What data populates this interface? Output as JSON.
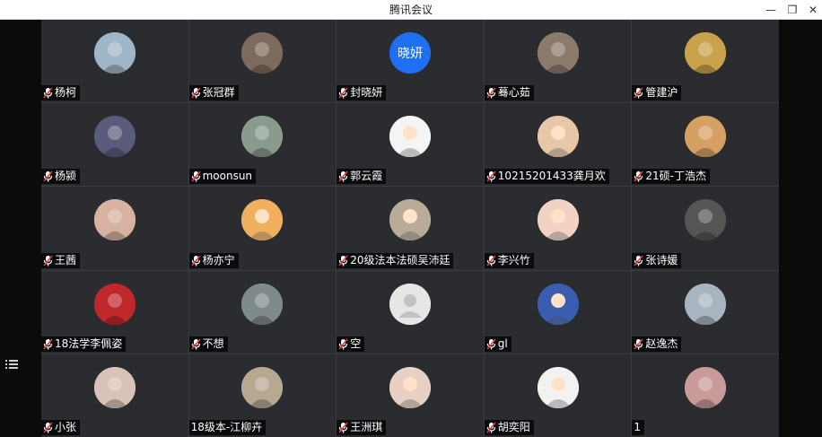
{
  "window": {
    "title": "腾讯会议",
    "controls": {
      "minimize": "—",
      "restore": "❐",
      "close": "✕"
    }
  },
  "sidebar": {
    "list_icon": "list-icon"
  },
  "participants": [
    {
      "name": "杨柯",
      "mic": true,
      "avatar": "photo",
      "avatar_color": "#9fb6c8"
    },
    {
      "name": "张冠群",
      "mic": true,
      "avatar": "photo",
      "avatar_color": "#7c6a5e"
    },
    {
      "name": "封晓妍",
      "mic": true,
      "avatar": "initials",
      "initials": "晓妍",
      "avatar_color": "#1f6ff2"
    },
    {
      "name": "蓦心茹",
      "mic": true,
      "avatar": "photo",
      "avatar_color": "#8b7b6b"
    },
    {
      "name": "管建沪",
      "mic": true,
      "avatar": "photo",
      "avatar_color": "#c9a24a"
    },
    {
      "name": "杨颍",
      "mic": true,
      "avatar": "photo",
      "avatar_color": "#5a5a7a"
    },
    {
      "name": "moonsun",
      "mic": true,
      "avatar": "photo",
      "avatar_color": "#8a9a8e"
    },
    {
      "name": "郭云霞",
      "mic": true,
      "avatar": "cartoon",
      "avatar_color": "#f4f4f4"
    },
    {
      "name": "10215201433龚月欢",
      "mic": true,
      "avatar": "cartoon",
      "avatar_color": "#e8c7a8"
    },
    {
      "name": "21硕-丁浩杰",
      "mic": true,
      "avatar": "photo",
      "avatar_color": "#d7a063"
    },
    {
      "name": "王茜",
      "mic": true,
      "avatar": "photo",
      "avatar_color": "#d7b2a0"
    },
    {
      "name": "杨亦宁",
      "mic": true,
      "avatar": "cartoon",
      "avatar_color": "#f0b060"
    },
    {
      "name": "20级法本法硕吴沛廷",
      "mic": true,
      "avatar": "cartoon",
      "avatar_color": "#b8ab98"
    },
    {
      "name": "李兴竹",
      "mic": true,
      "avatar": "cartoon",
      "avatar_color": "#f2d2c2"
    },
    {
      "name": "张诗媛",
      "mic": true,
      "avatar": "photo",
      "avatar_color": "#555555"
    },
    {
      "name": "18法学李佩姿",
      "mic": true,
      "avatar": "photo",
      "avatar_color": "#c0282b"
    },
    {
      "name": "不想",
      "mic": true,
      "avatar": "photo",
      "avatar_color": "#7f8a8d"
    },
    {
      "name": "空",
      "mic": true,
      "avatar": "default",
      "avatar_color": "#e6e6e6"
    },
    {
      "name": "gl",
      "mic": true,
      "avatar": "cartoon",
      "avatar_color": "#3a5db0"
    },
    {
      "name": "赵逸杰",
      "mic": true,
      "avatar": "photo",
      "avatar_color": "#a8b4c0"
    },
    {
      "name": "小张",
      "mic": true,
      "avatar": "photo",
      "avatar_color": "#d9c3b8"
    },
    {
      "name": "18级本-江柳卉",
      "mic": false,
      "avatar": "photo",
      "avatar_color": "#b7a892"
    },
    {
      "name": "王洲琪",
      "mic": true,
      "avatar": "cartoon",
      "avatar_color": "#e9d0c4"
    },
    {
      "name": "胡奕阳",
      "mic": true,
      "avatar": "cartoon",
      "avatar_color": "#f2f2f2"
    },
    {
      "name": "1",
      "mic": false,
      "avatar": "photo",
      "avatar_color": "#c99a9a"
    }
  ]
}
